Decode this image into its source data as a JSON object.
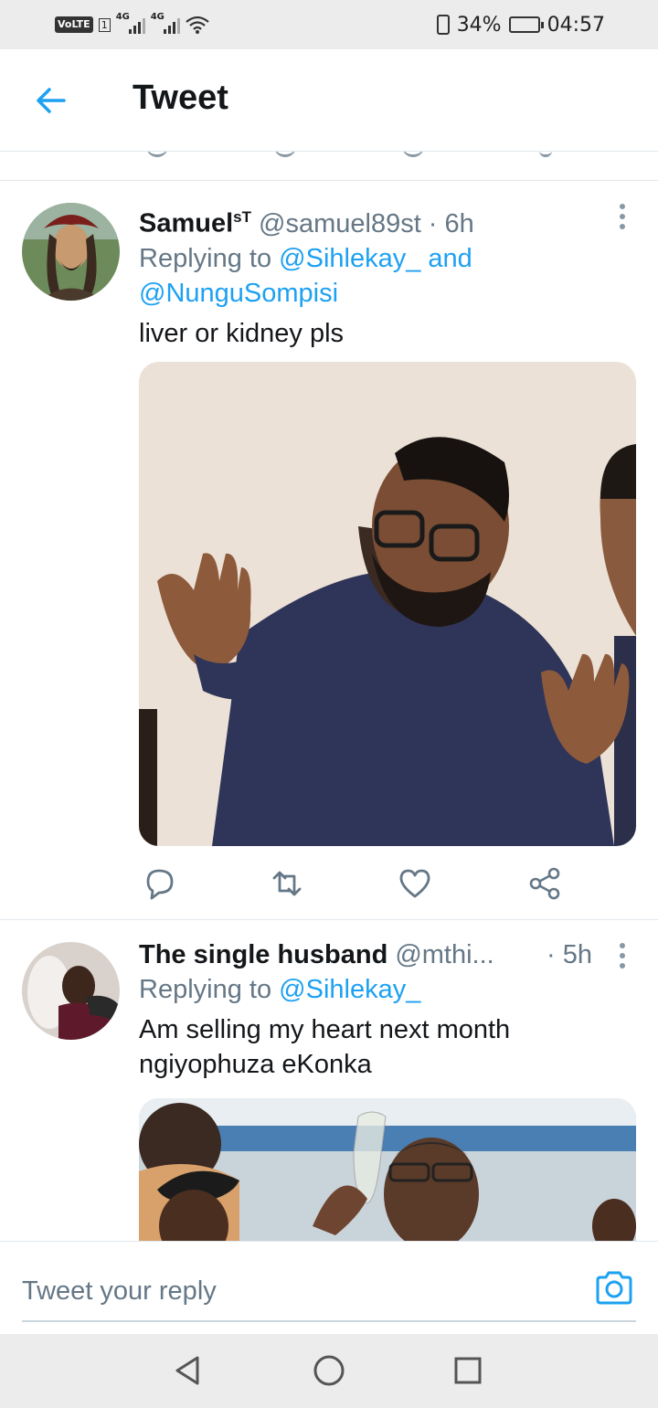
{
  "status_bar": {
    "volte": "VoLTE",
    "sim": "1",
    "network1": "4G",
    "network2": "4G",
    "battery_percent": "34%",
    "battery_level": 0.34,
    "time": "04:57"
  },
  "header": {
    "back_icon": "back-arrow-icon",
    "title": "Tweet"
  },
  "tweets": [
    {
      "name": "Samuel",
      "name_sup": "sT",
      "handle": "@samuel89st",
      "time": "· 6h",
      "replying_prefix": "Replying to ",
      "mentions_line1": "@Sihlekay_ and",
      "mentions_line2": "@NunguSompisi",
      "text": "liver or kidney pls",
      "media": "photo-man-raising-hands",
      "actions": [
        "reply-icon",
        "retweet-icon",
        "like-icon",
        "share-icon"
      ]
    },
    {
      "name": "The single husband",
      "handle": "@mthi...",
      "time": "· 5h",
      "replying_prefix": "Replying to ",
      "mentions_line1": "@Sihlekay_",
      "text_line1": "Am selling my heart next month",
      "text_line2": "ngiyophuza eKonka",
      "media": "photo-man-drinking-glass"
    }
  ],
  "compose": {
    "placeholder": "Tweet your reply",
    "camera_icon": "camera-icon"
  },
  "colors": {
    "accent": "#1da1f2",
    "secondary_text": "#657786",
    "primary_text": "#14171a",
    "icon_gray": "#8899a6"
  }
}
